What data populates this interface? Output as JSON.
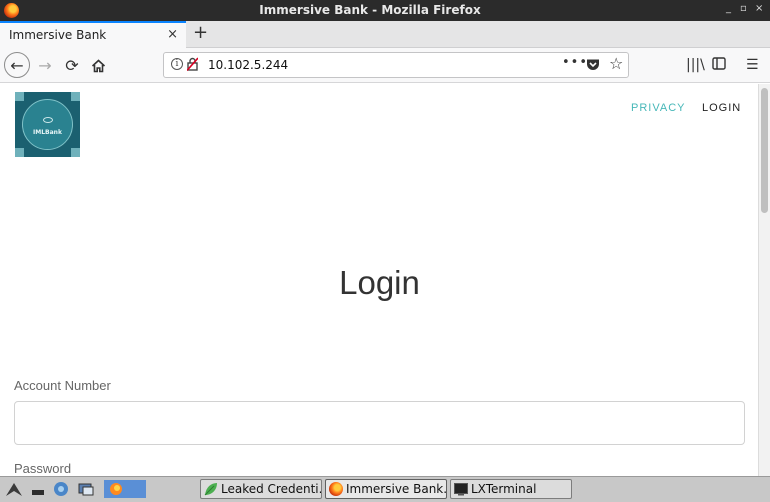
{
  "window": {
    "title": "Immersive Bank - Mozilla Firefox",
    "controls": {
      "minimize": "_",
      "maximize": "▫",
      "close": "×"
    }
  },
  "tabs": [
    {
      "title": "Immersive Bank",
      "close": "×"
    }
  ],
  "toolbar": {
    "new_tab": "+",
    "back": "←",
    "forward": "→",
    "reload": "⟳",
    "url": "10.102.5.244",
    "page_actions": "•••",
    "bookmark": "☆",
    "library": "|||\\",
    "sidebar": "▯",
    "menu": "☰",
    "info": "i"
  },
  "site": {
    "logo_text": "IMLBank",
    "nav": {
      "privacy": "PRIVACY",
      "login": "LOGIN"
    },
    "page_title": "Login",
    "form": {
      "account_label": "Account Number",
      "account_value": "",
      "password_label": "Password"
    }
  },
  "taskbar": {
    "items": [
      {
        "label": "Leaked Credenti..."
      },
      {
        "label": "Immersive Bank..."
      },
      {
        "label": "LXTerminal"
      }
    ]
  },
  "colors": {
    "accent_tab": "#0a84ff",
    "brand_teal": "#1b6070",
    "privacy_link": "#46b7b8"
  },
  "icons": [
    "firefox-icon",
    "info-icon",
    "insecure-lock-icon",
    "pocket-icon",
    "star-icon",
    "library-icon",
    "sidebar-icon",
    "menu-icon",
    "home-icon",
    "reload-icon"
  ]
}
